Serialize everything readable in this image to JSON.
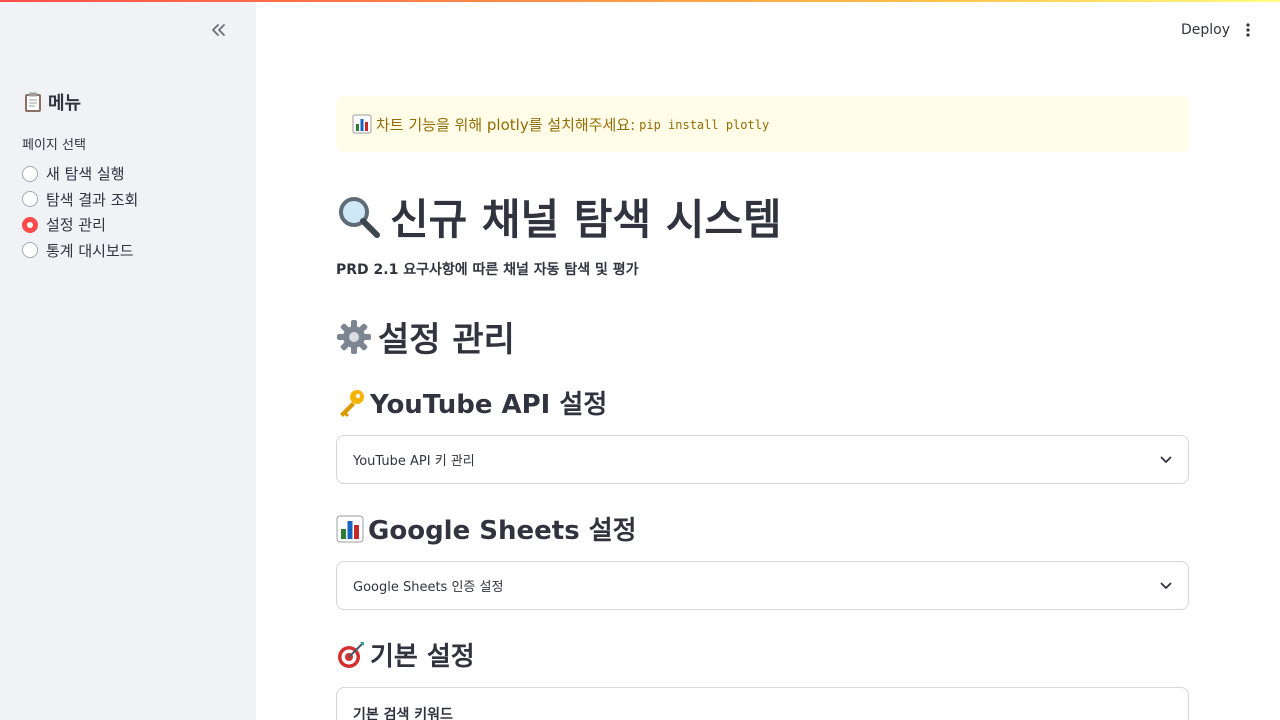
{
  "sidebar": {
    "title": "메뉴",
    "title_icon": "clipboard-icon",
    "radio_label": "페이지 선택",
    "options": [
      {
        "label": "새 탐색 실행",
        "selected": false
      },
      {
        "label": "탐색 결과 조회",
        "selected": false
      },
      {
        "label": "설정 관리",
        "selected": true
      },
      {
        "label": "통계 대시보드",
        "selected": false
      }
    ]
  },
  "header": {
    "deploy_label": "Deploy"
  },
  "alert": {
    "text": "차트 기능을 위해 plotly를 설치해주세요:",
    "code": "pip install plotly"
  },
  "page": {
    "title": "신규 채널 탐색 시스템",
    "subtitle": "PRD 2.1 요구사항에 따른 채널 자동 탐색 및 평가"
  },
  "sections": {
    "settings_title": "설정 관리",
    "youtube": {
      "title": "YouTube API 설정",
      "expander_label": "YouTube API 키 관리"
    },
    "sheets": {
      "title": "Google Sheets 설정",
      "expander_label": "Google Sheets 인증 설정"
    },
    "basic": {
      "title": "기본 설정",
      "field_label": "기본 검색 키워드"
    }
  },
  "colors": {
    "accent": "#ff4b4b",
    "sidebar_bg": "#f0f2f6",
    "warning_bg": "#fffce7",
    "warning_text": "#926c05",
    "text": "#31333f"
  }
}
